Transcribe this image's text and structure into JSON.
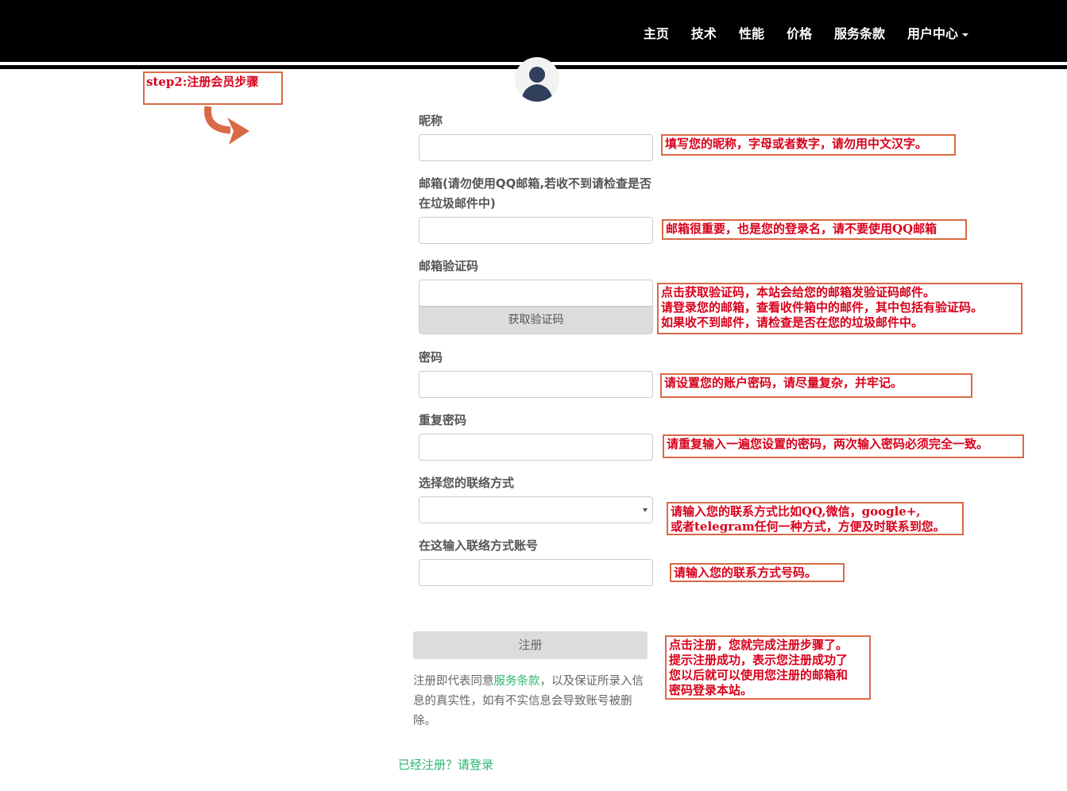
{
  "nav": {
    "items": [
      "主页",
      "技术",
      "性能",
      "价格",
      "服务条款"
    ],
    "user_center": "用户中心"
  },
  "step_label": "step2:注册会员步骤",
  "form": {
    "nickname_label": "昵称",
    "email_label": "邮箱(请勿使用QQ邮箱,若收不到请检查是否在垃圾邮件中)",
    "email_code_label": "邮箱验证码",
    "get_code_button": "获取验证码",
    "password_label": "密码",
    "repeat_password_label": "重复密码",
    "contact_method_label": "选择您的联络方式",
    "contact_account_label": "在这输入联络方式账号",
    "register_button": "注册",
    "terms_prefix": "注册即代表同意",
    "terms_link": "服务条款",
    "terms_suffix": "，以及保证所录入信息的真实性，如有不实信息会导致账号被删除。",
    "login_link": "已经注册？请登录"
  },
  "annotations": {
    "nickname": "填写您的昵称，字母或者数字，请勿用中文汉字。",
    "email": "邮箱很重要，也是您的登录名，请不要使用QQ邮箱",
    "code": "点击获取验证码，本站会给您的邮箱发验证码邮件。\n请登录您的邮箱，查看收件箱中的邮件，其中包括有验证码。\n如果收不到邮件，请检查是否在您的垃圾邮件中。",
    "password": "请设置您的账户密码，请尽量复杂，并牢记。",
    "repeat": "请重复输入一遍您设置的密码，两次输入密码必须完全一致。",
    "contact": "请输入您的联系方式比如QQ,微信，google+,\n或者telegram任何一种方式，方便及时联系到您。",
    "contact_account": "请输入您的联系方式号码。",
    "register": "点击注册，您就完成注册步骤了。\n提示注册成功，表示您注册成功了\n您以后就可以使用您注册的邮箱和\n密码登录本站。"
  },
  "colors": {
    "navbar": "#000000",
    "annotation_text": "#d9001b",
    "annotation_border": "#d96a46",
    "link_green": "#2bb673",
    "button_gray": "#dcdcdc"
  }
}
